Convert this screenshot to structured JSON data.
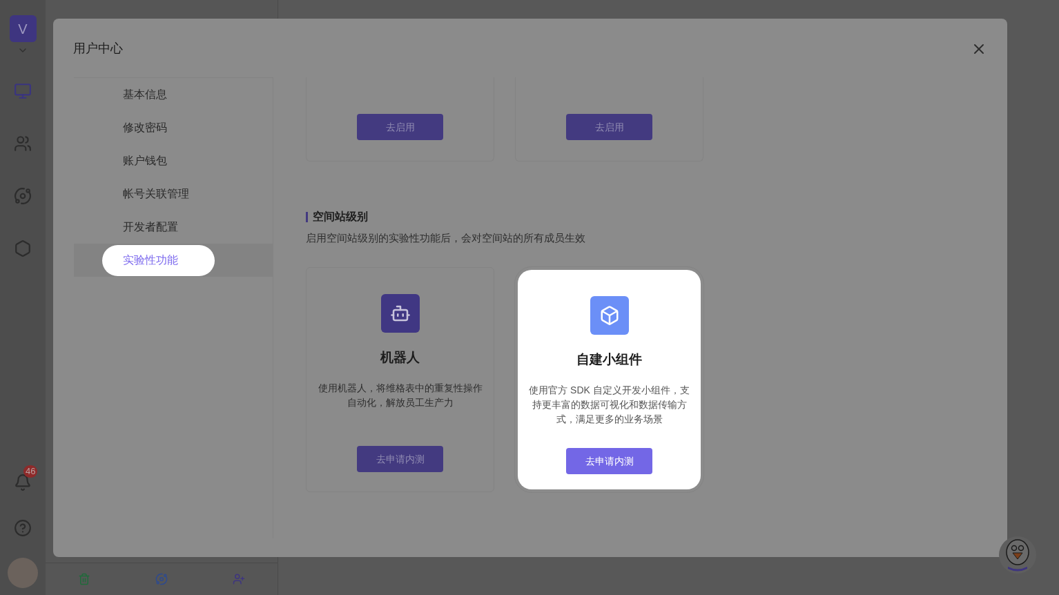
{
  "app": {
    "space_avatar": "V",
    "notification_count": "46"
  },
  "modal": {
    "title": "用户中心",
    "nav": [
      {
        "label": "基本信息",
        "selected": false
      },
      {
        "label": "修改密码",
        "selected": false
      },
      {
        "label": "账户钱包",
        "selected": false
      },
      {
        "label": "帐号关联管理",
        "selected": false
      },
      {
        "label": "开发者配置",
        "selected": false
      },
      {
        "label": "实验性功能",
        "selected": true
      }
    ],
    "top_cards": [
      {
        "button": "去启用"
      },
      {
        "button": "去启用"
      }
    ],
    "section": {
      "title": "空间站级别",
      "description": "启用空间站级别的实验性功能后，会对空间站的所有成员生效"
    },
    "cards": [
      {
        "kind": "robot",
        "title": "机器人",
        "description": "使用机器人，将维格表中的重复性操作自动化，解放员工生产力",
        "button": "去申请内测",
        "highlighted": false
      },
      {
        "kind": "widget",
        "title": "自建小组件",
        "description": "使用官方 SDK 自定义开发小组件，支持更丰富的数据可视化和数据传输方式，满足更多的业务场景",
        "button": "去申请内测",
        "highlighted": true
      }
    ]
  }
}
